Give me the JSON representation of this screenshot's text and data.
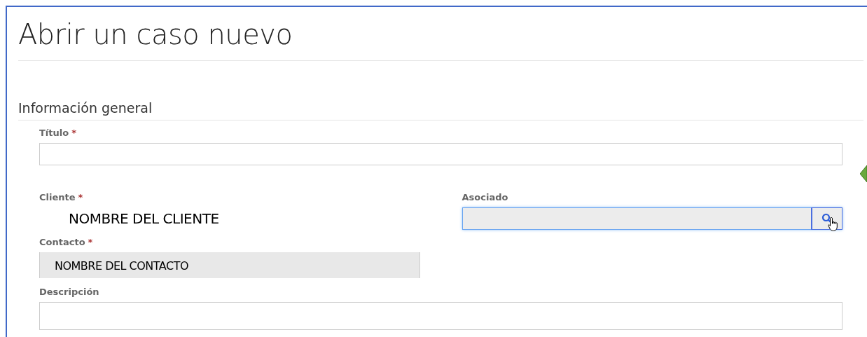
{
  "page": {
    "title": "Abrir un caso nuevo"
  },
  "section": {
    "heading": "Información general",
    "rows": [
      [
        {
          "kind": "text",
          "label": "Título",
          "required_mark": "*"
        }
      ],
      [
        {
          "kind": "display",
          "label": "Cliente",
          "required_mark": "*",
          "value": "NOMBRE DEL CLIENTE"
        },
        {
          "kind": "lookup",
          "label": "Asociado",
          "focused": true
        }
      ],
      [
        {
          "kind": "readonly",
          "label": "Contacto",
          "required_mark": "*",
          "value": "NOMBRE DEL CONTACTO"
        }
      ],
      [
        {
          "kind": "textarea",
          "label": "Descripción"
        }
      ]
    ]
  }
}
